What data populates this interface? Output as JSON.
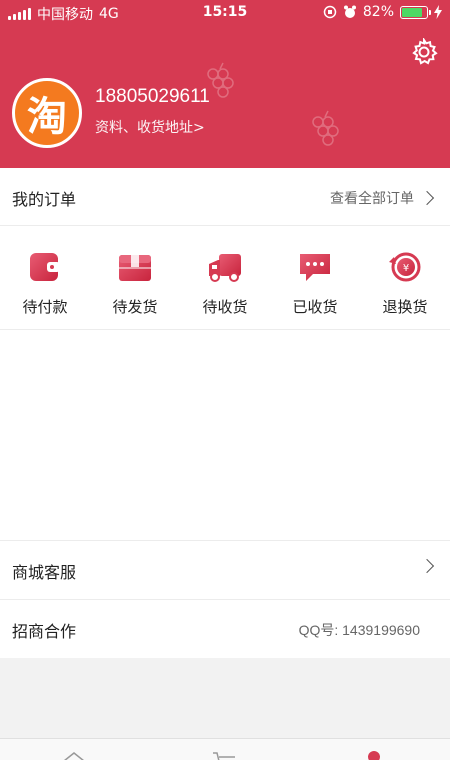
{
  "status_bar": {
    "carrier": "中国移动",
    "network": "4G",
    "time": "15:15",
    "battery": "82%",
    "battery_level": 0.82
  },
  "profile": {
    "phone": "18805029611",
    "link": "资料、收货地址>",
    "avatar_char": "淘"
  },
  "my_orders": {
    "title": "我的订单",
    "view_all": "查看全部订单"
  },
  "order_states": [
    {
      "label": "待付款",
      "icon": "wallet-icon"
    },
    {
      "label": "待发货",
      "icon": "package-icon"
    },
    {
      "label": "待收货",
      "icon": "truck-icon"
    },
    {
      "label": "已收货",
      "icon": "chat-icon"
    },
    {
      "label": "退换货",
      "icon": "refund-icon"
    }
  ],
  "menu": {
    "service": "商城客服",
    "business": "招商合作",
    "qq": "QQ号: 1439199690"
  },
  "colors": {
    "brand": "#d63a52",
    "avatar": "#f47a1f",
    "battery": "#4cd964"
  }
}
